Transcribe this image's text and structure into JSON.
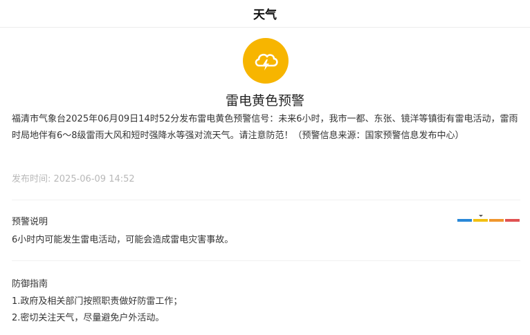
{
  "header": {
    "title": "天气"
  },
  "alert": {
    "icon": "thunderstorm-icon",
    "icon_color": "#f7b500",
    "title": "雷电黄色预警",
    "content": "福清市气象台2025年06月09日14时52分发布雷电黄色预警信号：未来6小时，我市一都、东张、镜洋等镇街有雷电活动，雷雨时局地伴有6～8级雷雨大风和短时强降水等强对流天气。请注意防范！（预警信息来源：国家预警信息发布中心）",
    "publish_time": "发布时间: 2025-06-09 14:52"
  },
  "warning_desc": {
    "label": "预警说明",
    "text": "6小时内可能发生雷电活动，可能会造成雷电灾害事故。"
  },
  "level_scale": {
    "colors": [
      "#2a88d8",
      "#f2c012",
      "#f0962e",
      "#e05252"
    ],
    "current_level_index": 1
  },
  "defense": {
    "label": "防御指南",
    "items": [
      "1.政府及相关部门按照职责做好防雷工作；",
      "2.密切关注天气，尽量避免户外活动。"
    ]
  }
}
